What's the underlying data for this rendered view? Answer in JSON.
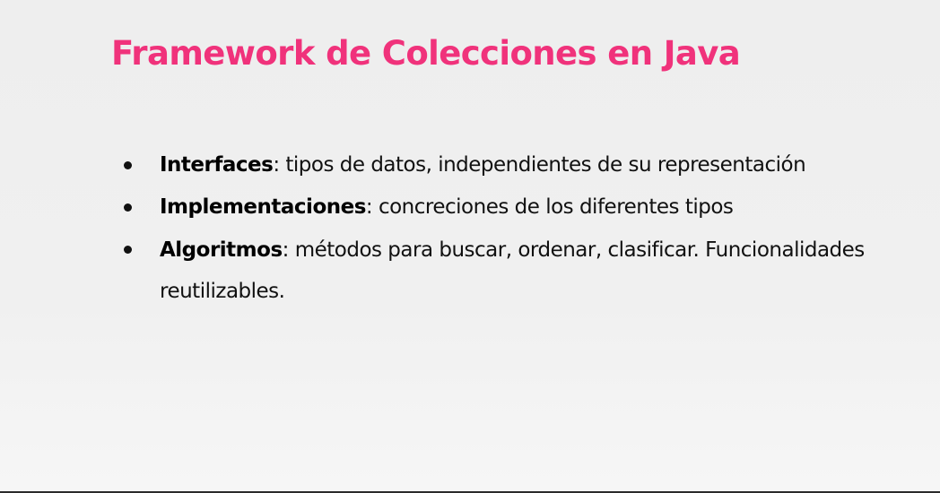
{
  "slide": {
    "title": "Framework de Colecciones en Java",
    "title_color": "#f0327b",
    "bullets": [
      {
        "term": "Interfaces",
        "description": ": tipos de datos, independientes de su representación"
      },
      {
        "term": "Implementaciones",
        "description": ": concreciones de los diferentes tipos"
      },
      {
        "term": "Algoritmos",
        "description": ": métodos para buscar, ordenar, clasificar. Funcionalidades reutilizables."
      }
    ]
  }
}
